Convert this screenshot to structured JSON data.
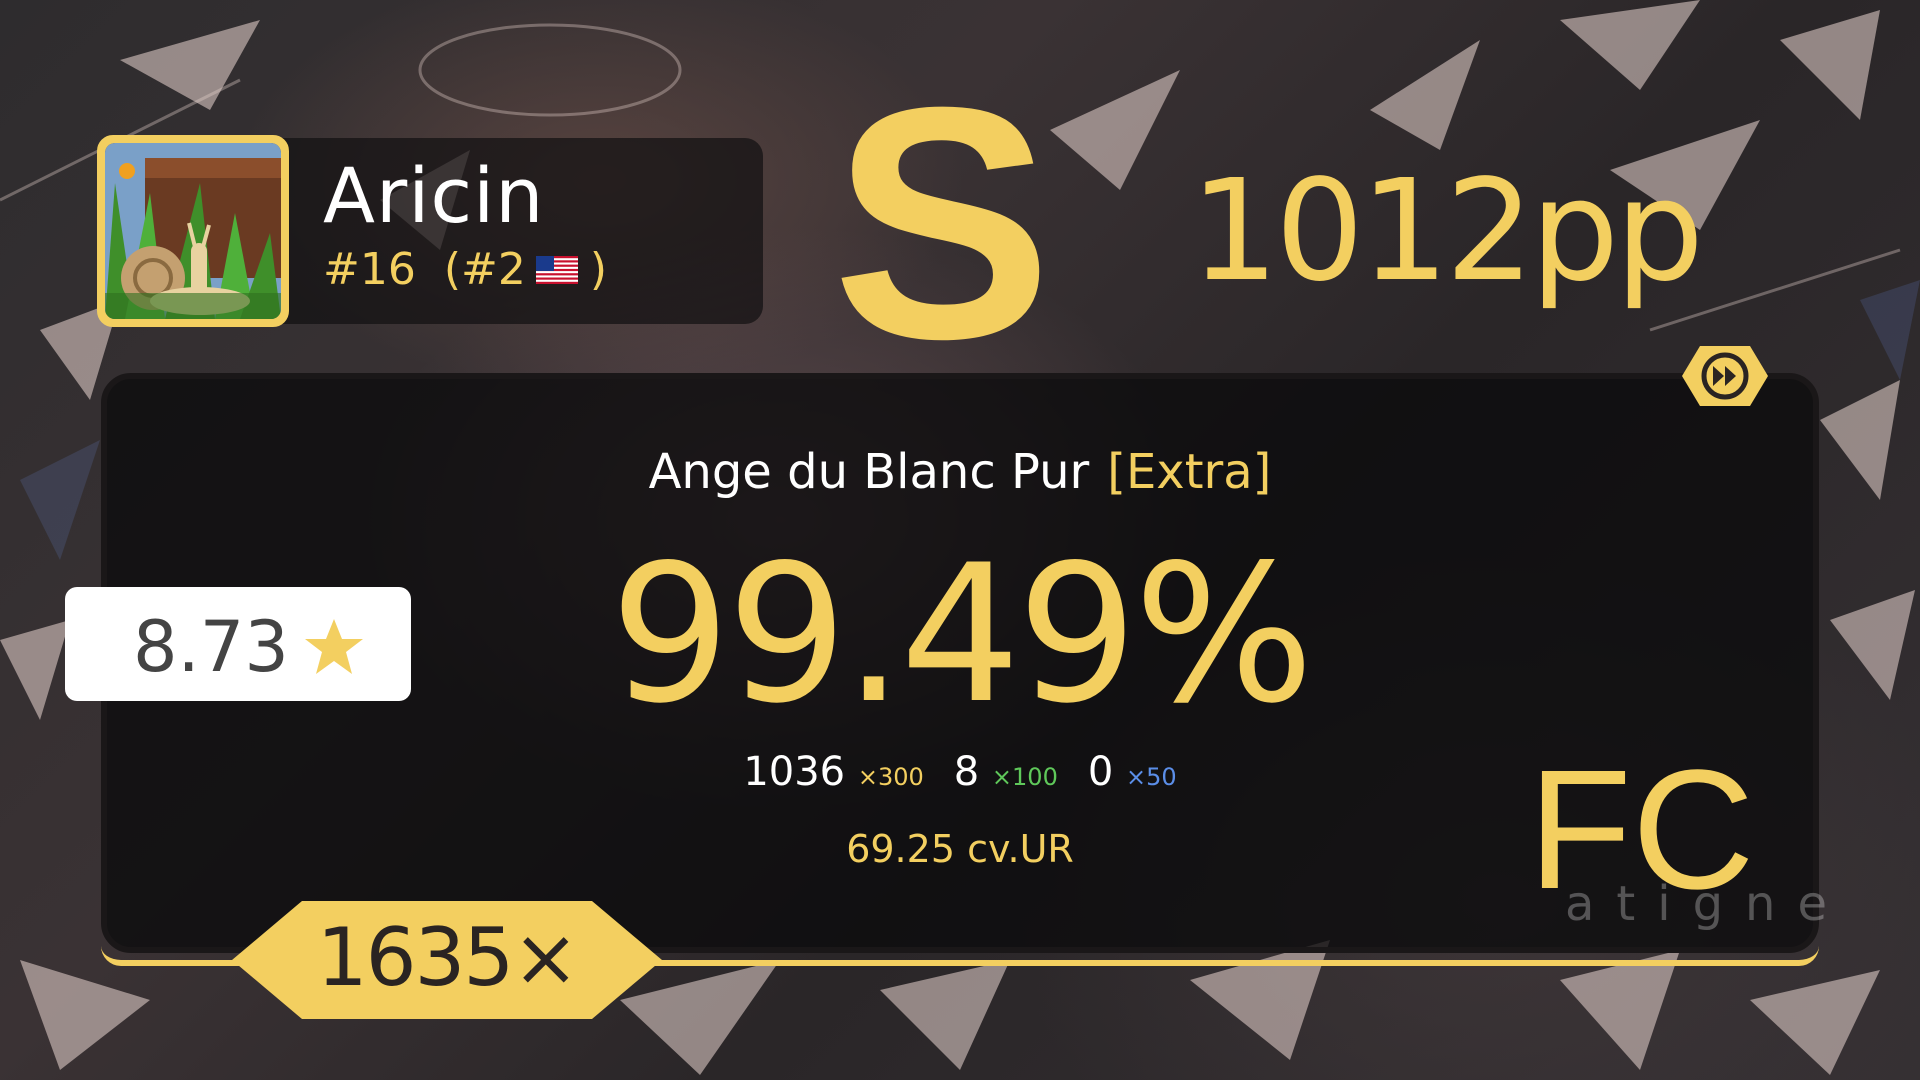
{
  "player": {
    "name": "Aricin",
    "global_rank": "#16",
    "country_rank": "(#2",
    "country_rank_close": ")",
    "country_flag": "us-flag-icon"
  },
  "score": {
    "grade": "S",
    "pp": "1012pp",
    "accuracy": "99.49%",
    "fc_label": "FC",
    "combo": "1635×",
    "star_rating": "8.73",
    "unstable_rate": "69.25 cv.UR",
    "mod_icon": "double-time-icon"
  },
  "beatmap": {
    "title": "Ange du Blanc Pur",
    "difficulty": "[Extra]"
  },
  "hits": {
    "count_300": "1036",
    "label_300": "×300",
    "count_100": "8",
    "label_100": "×100",
    "count_50": "0",
    "label_50": "×50"
  },
  "watermark": "atigne",
  "colors": {
    "accent": "#f3cf60",
    "hit_100": "#5fc85a",
    "hit_50": "#5b8ee8",
    "panel": "#0a0a0c"
  }
}
